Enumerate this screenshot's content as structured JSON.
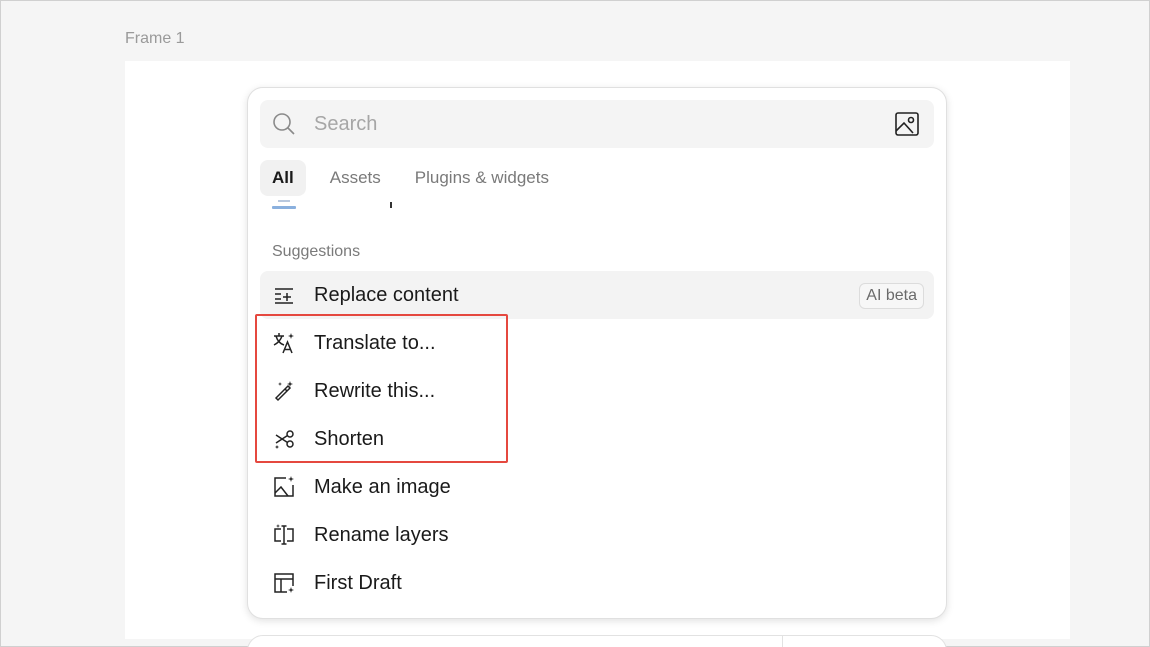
{
  "canvas": {
    "frame_label": "Frame 1"
  },
  "search": {
    "placeholder": "Search"
  },
  "tabs": [
    {
      "label": "All",
      "active": true
    },
    {
      "label": "Assets",
      "active": false
    },
    {
      "label": "Plugins & widgets",
      "active": false
    }
  ],
  "suggestions": {
    "heading": "Suggestions",
    "items": [
      {
        "label": "Replace content",
        "icon": "replace-content-icon",
        "badge": "AI beta"
      },
      {
        "label": "Translate to...",
        "icon": "translate-icon"
      },
      {
        "label": "Rewrite this...",
        "icon": "magic-wand-icon"
      },
      {
        "label": "Shorten",
        "icon": "scissors-icon"
      },
      {
        "label": "Make an image",
        "icon": "image-sparkle-icon"
      },
      {
        "label": "Rename layers",
        "icon": "rename-layers-icon"
      },
      {
        "label": "First Draft",
        "icon": "first-draft-icon"
      }
    ]
  },
  "colors": {
    "annotation": "#e5483f",
    "row_hover": "#f3f3f3"
  }
}
